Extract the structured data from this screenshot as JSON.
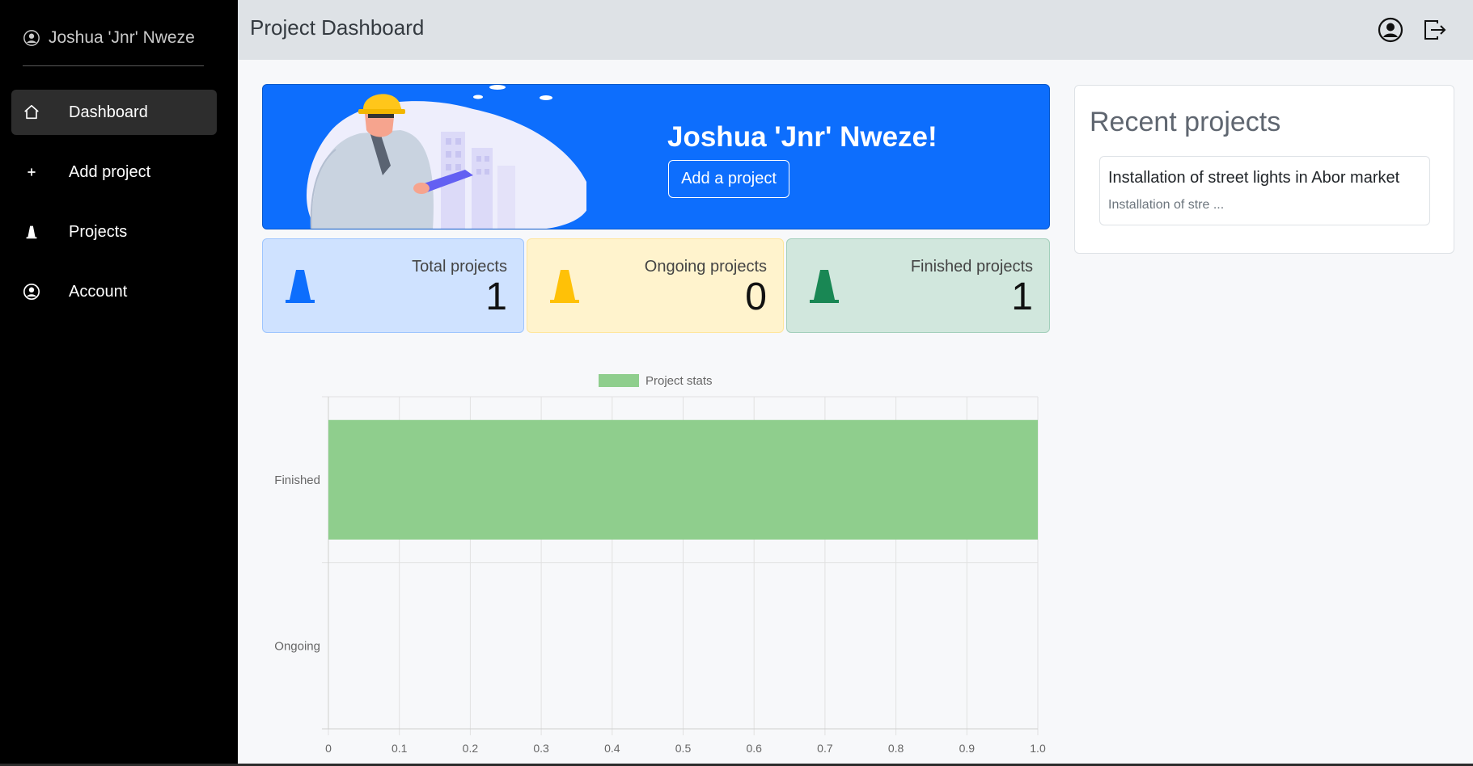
{
  "sidebar": {
    "user_name": "Joshua 'Jnr' Nweze",
    "items": [
      {
        "label": "Dashboard",
        "icon": "house-icon",
        "active": true
      },
      {
        "label": "Add project",
        "icon": "plus-icon",
        "active": false
      },
      {
        "label": "Projects",
        "icon": "cone-icon",
        "active": false
      },
      {
        "label": "Account",
        "icon": "person-circle-icon",
        "active": false
      }
    ]
  },
  "header": {
    "title": "Project Dashboard",
    "icons": [
      "account-icon",
      "logout-icon"
    ]
  },
  "hero": {
    "greeting": "Joshua 'Jnr' Nweze!",
    "button_label": "Add a project",
    "bg_color": "#0d6efd"
  },
  "stats": [
    {
      "label": "Total projects",
      "value": "1",
      "color": "#0d6efd",
      "bg": "#cfe2ff"
    },
    {
      "label": "Ongoing projects",
      "value": "0",
      "color": "#ffc107",
      "bg": "#fff3cd"
    },
    {
      "label": "Finished projects",
      "value": "1",
      "color": "#198754",
      "bg": "#d1e7dd"
    }
  ],
  "recent": {
    "title": "Recent projects",
    "items": [
      {
        "title": "Installation of street lights in Abor market",
        "desc": "Installation of stre ..."
      }
    ]
  },
  "chart_data": {
    "type": "bar",
    "orientation": "horizontal",
    "categories": [
      "Finished",
      "Ongoing"
    ],
    "series": [
      {
        "name": "Project stats",
        "values": [
          1,
          0
        ],
        "color": "#8fce8d"
      }
    ],
    "xlim": [
      0,
      1
    ],
    "xticks": [
      "0",
      "0.1",
      "0.2",
      "0.3",
      "0.4",
      "0.5",
      "0.6",
      "0.7",
      "0.8",
      "0.9",
      "1.0"
    ],
    "grid": true,
    "legend": "top"
  }
}
